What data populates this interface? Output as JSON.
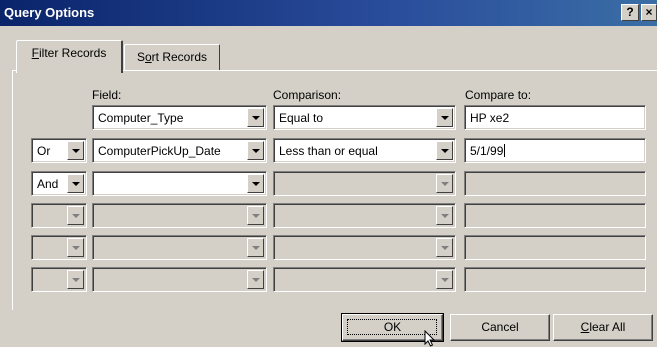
{
  "window": {
    "title": "Query Options",
    "help_glyph": "?",
    "close_glyph": "×"
  },
  "tabs": [
    {
      "first": "F",
      "rest": "ilter Records",
      "active": true
    },
    {
      "pre": "S",
      "under": "o",
      "rest": "rt Records",
      "active": false
    }
  ],
  "headers": {
    "field": "Field:",
    "comparison": "Comparison:",
    "compare_to": "Compare to:"
  },
  "rows": [
    {
      "conj": "",
      "field": "Computer_Type",
      "comparison": "Equal to",
      "value": "HP xe2"
    },
    {
      "conj": "Or",
      "field": "ComputerPickUp_Date",
      "comparison": "Less than or equal",
      "value": "5/1/99"
    },
    {
      "conj": "And",
      "field": "",
      "comparison": "",
      "value": ""
    },
    {
      "conj": "",
      "field": "",
      "comparison": "",
      "value": ""
    },
    {
      "conj": "",
      "field": "",
      "comparison": "",
      "value": ""
    },
    {
      "conj": "",
      "field": "",
      "comparison": "",
      "value": ""
    }
  ],
  "buttons": {
    "ok": "OK",
    "cancel": "Cancel",
    "clear_first": "C",
    "clear_rest": "lear All"
  },
  "icons": [
    "help-icon",
    "close-icon",
    "dropdown-arrow-icon",
    "mouse-pointer-icon"
  ]
}
